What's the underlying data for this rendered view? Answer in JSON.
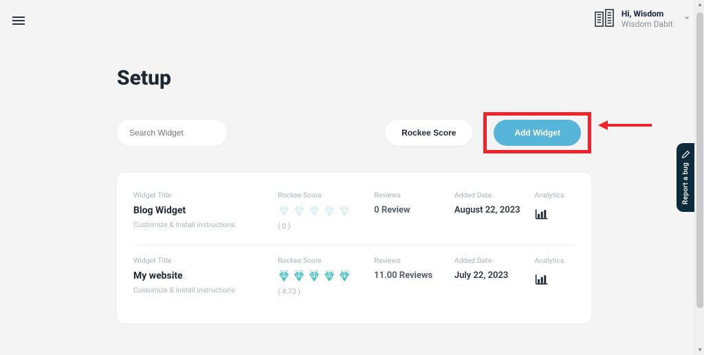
{
  "header": {
    "greeting": "Hi, Wisdom",
    "username": "Wisdom Dabit"
  },
  "page": {
    "title": "Setup",
    "search_placeholder": "Search Widget",
    "rockee_score_btn": "Rockee Score",
    "add_widget_btn": "Add Widget"
  },
  "columns": {
    "widget_title": "Widget Title",
    "rockee_score": "Rockee Score",
    "reviews": "Reviews",
    "added_date": "Added Date",
    "analytics": "Analytics",
    "customize": "Customize & Install instructions"
  },
  "widgets": [
    {
      "title": "Blog Widget",
      "score": "( 0 )",
      "filled": 0,
      "reviews": "0 Review",
      "added": "August 22, 2023"
    },
    {
      "title": "My website",
      "score": "( 4.73 )",
      "filled": 5,
      "reviews": "11.00 Reviews",
      "added": "July 22, 2023"
    }
  ],
  "report_bug": "Report a bug",
  "colors": {
    "accent": "#56b5d8",
    "highlight_box": "#f0232a",
    "diamond_filled": "#3bbfc6",
    "diamond_empty": "#d6eef3"
  }
}
